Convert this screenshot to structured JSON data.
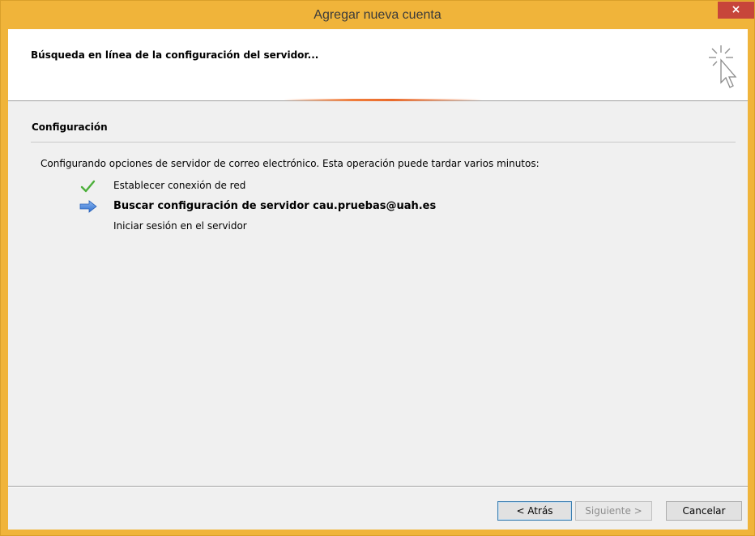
{
  "window": {
    "title": "Agregar nueva cuenta",
    "close_label": "×"
  },
  "header": {
    "title": "Búsqueda en línea de la configuración del servidor..."
  },
  "section": {
    "title": "Configuración",
    "intro": "Configurando opciones de servidor de correo electrónico. Esta operación puede tardar varios minutos:"
  },
  "steps": [
    {
      "label": "Establecer conexión de red",
      "status": "done",
      "icon": "checkmark-icon"
    },
    {
      "label": "Buscar configuración de servidor cau.pruebas@uah.es",
      "status": "in-progress",
      "icon": "arrow-right-icon"
    },
    {
      "label": "Iniciar sesión en el servidor",
      "status": "pending",
      "icon": ""
    }
  ],
  "buttons": {
    "back": "< Atrás",
    "next": "Siguiente >",
    "cancel": "Cancelar"
  },
  "colors": {
    "titlebar": "#f0b43a",
    "close": "#c7453a",
    "check": "#4caf3a",
    "arrow": "#3a78d8",
    "progress": "#ea6a2a"
  }
}
